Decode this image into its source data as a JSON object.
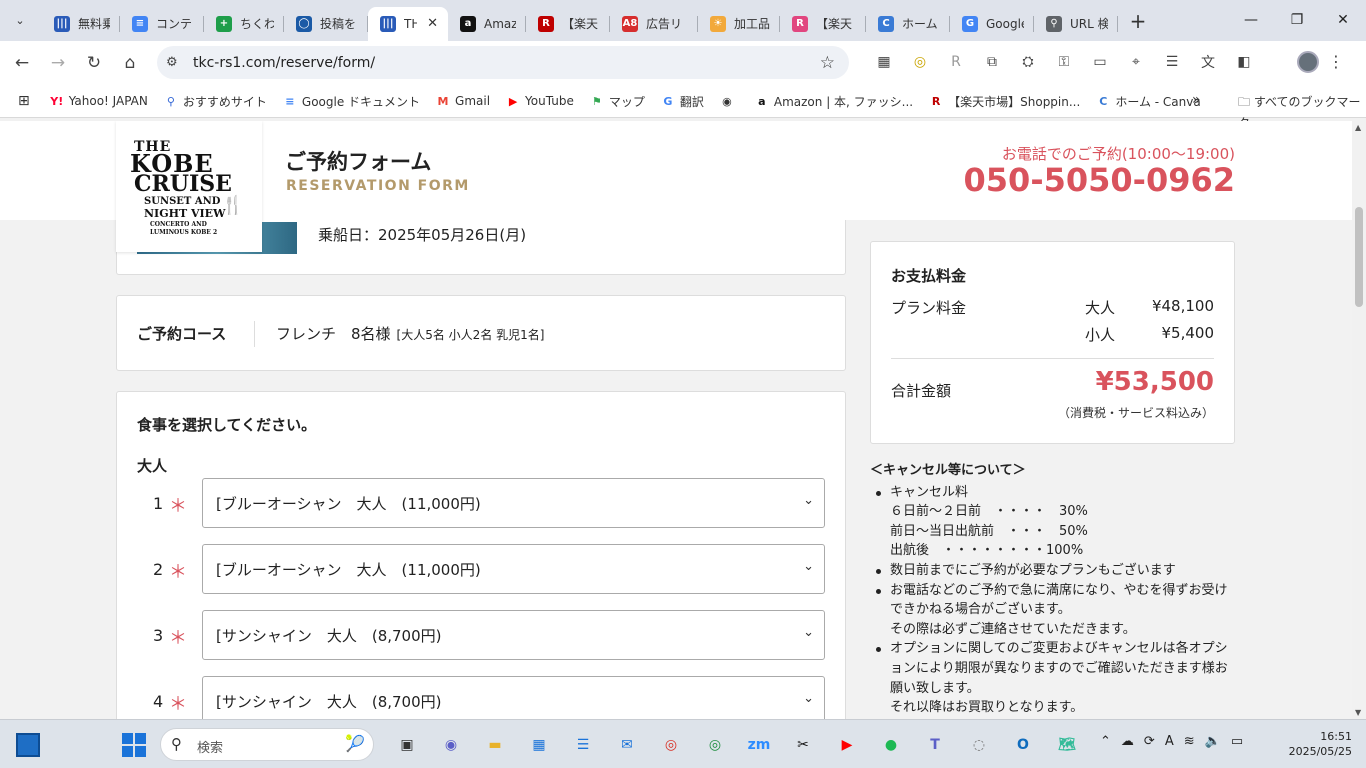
{
  "browser": {
    "tabs": [
      {
        "title": "無料乗",
        "icon": "#2a5bb8",
        "glyph": "|||"
      },
      {
        "title": "コンテ",
        "icon": "#4285f4",
        "glyph": "≡"
      },
      {
        "title": "ちくわの",
        "icon": "#1e9e4a",
        "glyph": "+"
      },
      {
        "title": "投稿を",
        "icon": "#1b5aa6",
        "glyph": "◯"
      },
      {
        "title": "TH",
        "icon": "#2a5bb8",
        "glyph": "|||",
        "active": true
      },
      {
        "title": "Amazo",
        "icon": "#111111",
        "glyph": "a"
      },
      {
        "title": "【楽天",
        "icon": "#bf0000",
        "glyph": "R"
      },
      {
        "title": "広告リ",
        "icon": "#d62e2e",
        "glyph": "A8"
      },
      {
        "title": "加工品",
        "icon": "#f2a93b",
        "glyph": "☀"
      },
      {
        "title": "【楽天",
        "icon": "#e1467f",
        "glyph": "R"
      },
      {
        "title": "ホーム -",
        "icon": "#3a7bd5",
        "glyph": "C"
      },
      {
        "title": "Google",
        "icon": "#4285f4",
        "glyph": "G"
      },
      {
        "title": "URL 検",
        "icon": "#5f6368",
        "glyph": "⚲"
      }
    ],
    "url": "tkc-rs1.com/reserve/form/",
    "bookmarks": [
      {
        "label": "Yahoo! JAPAN",
        "color": "#ff0033",
        "glyph": "Y!"
      },
      {
        "label": "おすすめサイト",
        "color": "#3367d6",
        "glyph": "⚲"
      },
      {
        "label": "Google ドキュメント",
        "color": "#4285f4",
        "glyph": "≡"
      },
      {
        "label": "Gmail",
        "color": "#ea4335",
        "glyph": "M"
      },
      {
        "label": "YouTube",
        "color": "#ff0000",
        "glyph": "▶"
      },
      {
        "label": "マップ",
        "color": "#34a853",
        "glyph": "⚑"
      },
      {
        "label": "翻訳",
        "color": "#4285f4",
        "glyph": "G"
      },
      {
        "label": "",
        "color": "#333333",
        "glyph": "◉"
      },
      {
        "label": "Amazon | 本, ファッシ...",
        "color": "#111111",
        "glyph": "a"
      },
      {
        "label": "【楽天市場】Shoppin...",
        "color": "#bf0000",
        "glyph": "R"
      },
      {
        "label": "ホーム - Canva",
        "color": "#3a7bd5",
        "glyph": "C"
      }
    ],
    "all_bookmarks": "すべてのブックマーク"
  },
  "page": {
    "form_title": "ご予約フォーム",
    "form_subtitle": "RESERVATION FORM",
    "phone_label": "お電話でのご予約(10:00～19:00)",
    "phone": "050-5050-0962",
    "logo": {
      "l1": "THE",
      "l2": "KOBE",
      "l3": "CRUISE",
      "l4": "SUNSET AND",
      "l5": "NIGHT VIEW",
      "l6": "CONCERTO AND",
      "l7": "LUMINOUS KOBE 2"
    },
    "boarding_date": "乗船日：2025年05月26日(月)",
    "course_label": "ご予約コース",
    "course_value": "フレンチ　8名様",
    "course_detail": "[大人5名 小人2名 乳児1名]",
    "meal_prompt": "食事を選択してください。",
    "adult_label": "大人",
    "meal_rows": [
      {
        "num": "1",
        "option": "[ブルーオーシャン　大人　(11,000円)"
      },
      {
        "num": "2",
        "option": "[ブルーオーシャン　大人　(11,000円)"
      },
      {
        "num": "3",
        "option": "[サンシャイン　大人　(8,700円)"
      },
      {
        "num": "4",
        "option": "[サンシャイン　大人　(8,700円)"
      }
    ],
    "required_mark": "＊",
    "payment": {
      "heading": "お支払料金",
      "plan_label": "プラン料金",
      "adult_label": "大人",
      "adult_price": "¥48,100",
      "child_label": "小人",
      "child_price": "¥5,400",
      "total_label": "合計金額",
      "total_price": "¥53,500",
      "tax_note": "（消費税・サービス料込み）"
    },
    "cancel": {
      "heading": "＜キャンセル等について＞",
      "items": [
        "キャンセル料",
        "数日前までにご予約が必要なプランもございます",
        "お電話などのご予約で急に満席になり、やむを得ずお受けできかねる場合がございます。",
        "オプションに関してのご変更およびキャンセルは各オプションにより期限が異なりますのでご確認いただきます様お願い致します。"
      ],
      "fee_lines": [
        "６日前～２日前　・・・・　30%",
        "前日～当日出航前　・・・　50%",
        "出航後　・・・・・・・・100%"
      ],
      "contact_note": "その際は必ずご連絡させていただきます。",
      "option_note": "それ以降はお買取りとなります。"
    }
  },
  "taskbar": {
    "search_placeholder": "検索",
    "time": "16:51",
    "date": "2025/05/25"
  }
}
